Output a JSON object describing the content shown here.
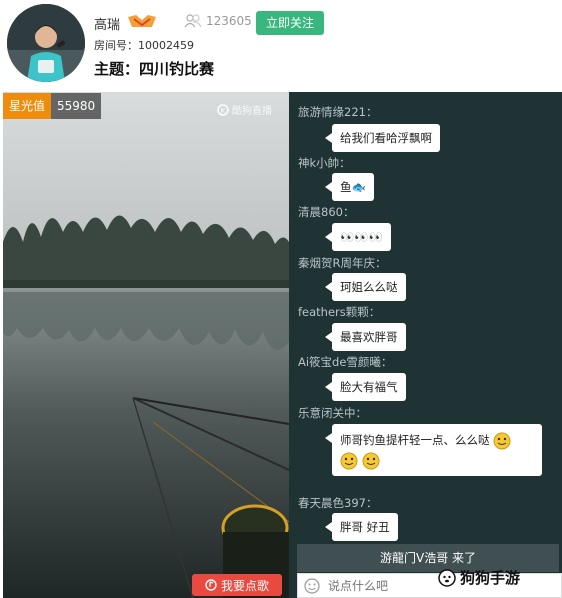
{
  "header": {
    "anchor_name": "高瑞",
    "fans_count": "123605",
    "follow_label": "立即关注",
    "room_label": "房间号：",
    "room_number": "10002459",
    "topic_label": "主题：",
    "topic": "四川钓比赛"
  },
  "video": {
    "star_label": "星光值",
    "star_value": "55980",
    "watermark": "酷狗直播",
    "song_button": "我要点歌"
  },
  "chat": {
    "messages": [
      {
        "user": "旅游情缘221：",
        "text": "给我们看哈浮飘啊"
      },
      {
        "user": "神k小帥：",
        "text": "鱼🐟"
      },
      {
        "user": "清晨860：",
        "text": "👀👀👀"
      },
      {
        "user": "秦烟贺R周年庆：",
        "text": "珂姐么么哒"
      },
      {
        "user": "feathers颗颗：",
        "text": "最喜欢胖哥"
      },
      {
        "user": "Ai筱宝de雪颜曦：",
        "text": "脸大有福气"
      },
      {
        "user": "乐意闭关中：",
        "text": "师哥钓鱼提杆轻一点、么么哒"
      },
      {
        "user": "春天晨色397：",
        "text": "胖哥 好丑"
      }
    ],
    "notice": "游龍门V浩哥 来了",
    "input_placeholder": "说点什么吧"
  },
  "sitemark": "狗狗手游",
  "colors": {
    "accent_green": "#3ab67f",
    "star_orange": "#f08c0c",
    "song_red": "#e9493f",
    "chat_bg": "#1f3234"
  }
}
